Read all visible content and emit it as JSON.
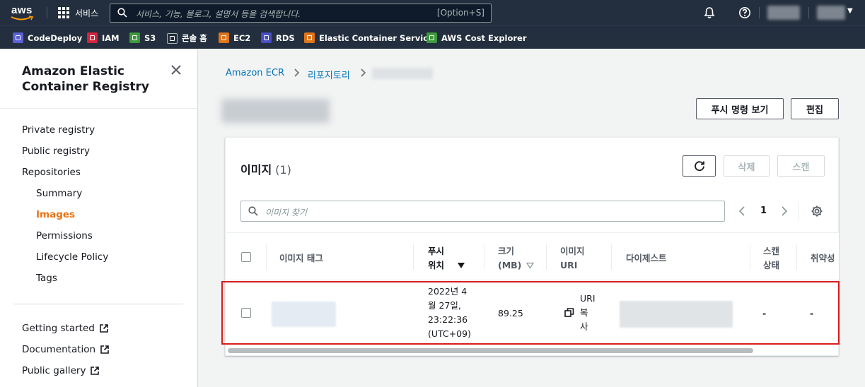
{
  "topnav": {
    "logo_text": "aws",
    "services_label": "서비스",
    "search_placeholder": "서비스, 기능, 블로그, 설명서 등을 검색합니다.",
    "search_shortcut": "[Option+S]"
  },
  "favorites": [
    {
      "label": "CodeDeploy",
      "color": "#5a5fd6"
    },
    {
      "label": "IAM",
      "color": "#d6233c"
    },
    {
      "label": "S3",
      "color": "#3c9a3c"
    },
    {
      "label": "콘솔 홈",
      "color": "#232f3e"
    },
    {
      "label": "EC2",
      "color": "#e0741a"
    },
    {
      "label": "RDS",
      "color": "#4a4ec4"
    },
    {
      "label": "Elastic Container Service",
      "color": "#e0741a"
    },
    {
      "label": "AWS Cost Explorer",
      "color": "#3c9a3c"
    }
  ],
  "sidebar": {
    "title": "Amazon Elastic Container Registry",
    "items": [
      {
        "label": "Private registry"
      },
      {
        "label": "Public registry"
      },
      {
        "label": "Repositories"
      },
      {
        "label": "Summary"
      },
      {
        "label": "Images"
      },
      {
        "label": "Permissions"
      },
      {
        "label": "Lifecycle Policy"
      },
      {
        "label": "Tags"
      }
    ],
    "links": [
      {
        "label": "Getting started"
      },
      {
        "label": "Documentation"
      },
      {
        "label": "Public gallery"
      }
    ]
  },
  "breadcrumb": {
    "items": [
      "Amazon ECR",
      "리포지토리"
    ]
  },
  "header": {
    "push_button": "푸시 명령 보기",
    "edit_button": "편집"
  },
  "images_panel": {
    "title": "이미지",
    "count": "(1)",
    "delete_button": "삭제",
    "scan_button": "스캔",
    "filter_placeholder": "이미지 찾기",
    "page": "1",
    "columns": {
      "tag": "이미지 태그",
      "push_line1": "푸시",
      "push_line2": "위치",
      "size_line1": "크기",
      "size_line2": "(MB)",
      "uri_line1": "이미지",
      "uri_line2": "URI",
      "digest": "다이제스트",
      "scan_line1": "스캔",
      "scan_line2": "상태",
      "vuln": "취약성"
    },
    "rows": [
      {
        "pushed_line1": "2022년 4",
        "pushed_line2": "월 27일,",
        "pushed_line3": "23:22:36",
        "pushed_line4": "(UTC+09)",
        "size": "89.25",
        "copy_uri_line1": "URI",
        "copy_uri_line2": "복",
        "copy_uri_line3": "사",
        "scan_status": "-",
        "vulnerabilities": "-"
      }
    ]
  },
  "colors": {
    "nav_bg": "#232f3e",
    "link": "#0073bb",
    "active": "#ec7211",
    "highlight": "#d91c1c"
  }
}
